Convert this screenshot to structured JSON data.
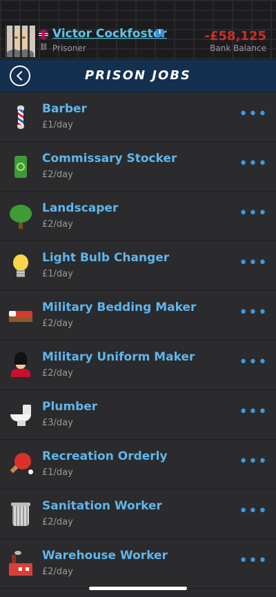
{
  "header": {
    "player_name": "Victor Cockfoster",
    "status": "Prisoner",
    "balance": "-£58,125",
    "balance_label": "Bank Balance",
    "avatar_icon": "prisoner-avatar",
    "flag_icon": "uk-flag-icon",
    "info_icon": "info-icon",
    "info_glyph": "i",
    "status_icon": "handcuffs-icon",
    "status_glyph": "⛓"
  },
  "navbar": {
    "title": "PRISON JOBS",
    "back_icon": "back-arrow-icon"
  },
  "jobs": [
    {
      "title": "Barber",
      "pay": "£1/day",
      "icon": "barber-pole-icon"
    },
    {
      "title": "Commissary Stocker",
      "pay": "£2/day",
      "icon": "canned-food-icon"
    },
    {
      "title": "Landscaper",
      "pay": "£2/day",
      "icon": "tree-icon"
    },
    {
      "title": "Light Bulb Changer",
      "pay": "£1/day",
      "icon": "light-bulb-icon"
    },
    {
      "title": "Military Bedding Maker",
      "pay": "£2/day",
      "icon": "bed-icon"
    },
    {
      "title": "Military Uniform Maker",
      "pay": "£2/day",
      "icon": "guard-icon"
    },
    {
      "title": "Plumber",
      "pay": "£3/day",
      "icon": "toilet-icon"
    },
    {
      "title": "Recreation Orderly",
      "pay": "£1/day",
      "icon": "ping-pong-icon"
    },
    {
      "title": "Sanitation Worker",
      "pay": "£2/day",
      "icon": "trash-can-icon"
    },
    {
      "title": "Warehouse Worker",
      "pay": "£2/day",
      "icon": "factory-icon"
    }
  ],
  "more_glyph": "•••",
  "colors": {
    "name": "#5ac8e6",
    "balance": "#c9302c",
    "job_title": "#5fb6ec",
    "nav_bg": "#13304f",
    "more_dots": "#3b9be4"
  }
}
